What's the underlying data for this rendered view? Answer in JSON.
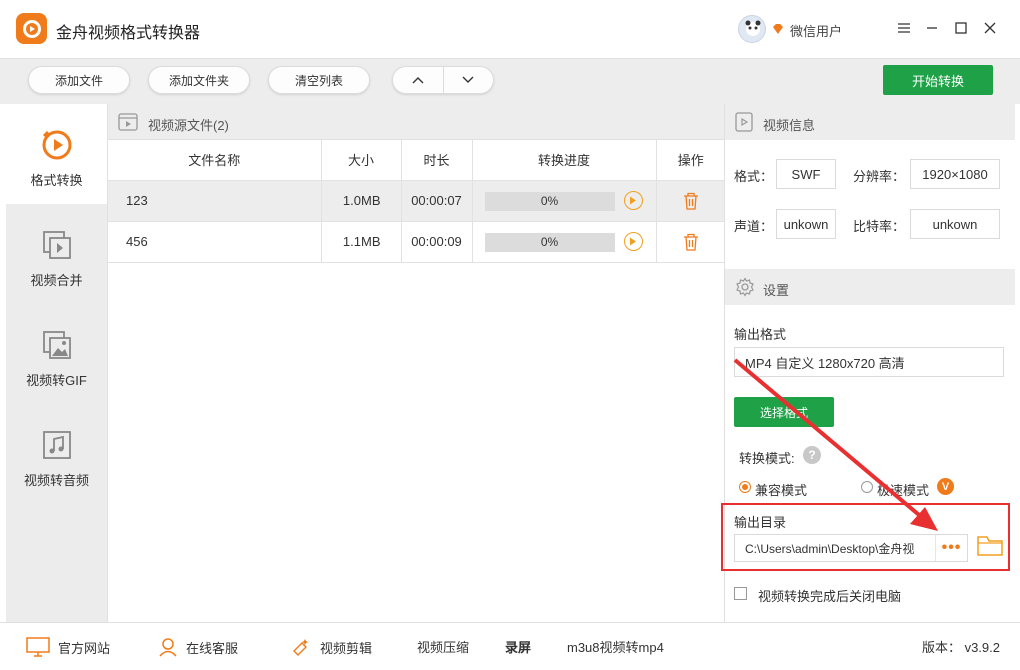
{
  "app": {
    "title": "金舟视频格式转换器",
    "user_name": "微信用户"
  },
  "colors": {
    "accent": "#1fa148",
    "orange": "#f07b1a",
    "highlight": "#e83030"
  },
  "toolbar": {
    "add_file": "添加文件",
    "add_folder": "添加文件夹",
    "clear_list": "清空列表",
    "start": "开始转换"
  },
  "sidebar": {
    "items": [
      {
        "label": "格式转换",
        "icon": "convert-icon",
        "active": true
      },
      {
        "label": "视频合并",
        "icon": "merge-icon",
        "active": false
      },
      {
        "label": "视频转GIF",
        "icon": "gif-icon",
        "active": false
      },
      {
        "label": "视频转音频",
        "icon": "audio-icon",
        "active": false
      }
    ]
  },
  "file_panel": {
    "title": "视频源文件(2)",
    "columns": [
      "文件名称",
      "大小",
      "时长",
      "转换进度",
      "操作"
    ],
    "rows": [
      {
        "name": "123",
        "size": "1.0MB",
        "duration": "00:00:07",
        "progress": "0%",
        "progress_value": 0
      },
      {
        "name": "456",
        "size": "1.1MB",
        "duration": "00:00:09",
        "progress": "0%",
        "progress_value": 0
      }
    ]
  },
  "video_info": {
    "title": "视频信息",
    "format_label": "格式：",
    "format_value": "SWF",
    "resolution_label": "分辨率：",
    "resolution_value": "1920×1080",
    "channel_label": "声道：",
    "channel_value": "unkown",
    "bitrate_label": "比特率：",
    "bitrate_value": "unkown"
  },
  "settings": {
    "title": "设置",
    "output_format_label": "输出格式",
    "output_format_value": "MP4 自定义 1280x720 高清",
    "choose_format": "选择格式",
    "mode_label": "转换模式:",
    "help": "?",
    "mode_compatible": "兼容模式",
    "mode_fast": "极速模式",
    "vip_badge": "V",
    "output_dir_label": "输出目录",
    "output_dir_value": "C:\\Users\\admin\\Desktop\\金舟视",
    "more": "•••",
    "shutdown_label": "视频转换完成后关闭电脑"
  },
  "statusbar": {
    "website": "官方网站",
    "support": "在线客服",
    "edit": "视频剪辑",
    "compress": "视频压缩",
    "record": "录屏",
    "m3u8": "m3u8视频转mp4",
    "version": "版本：  v3.9.2"
  }
}
